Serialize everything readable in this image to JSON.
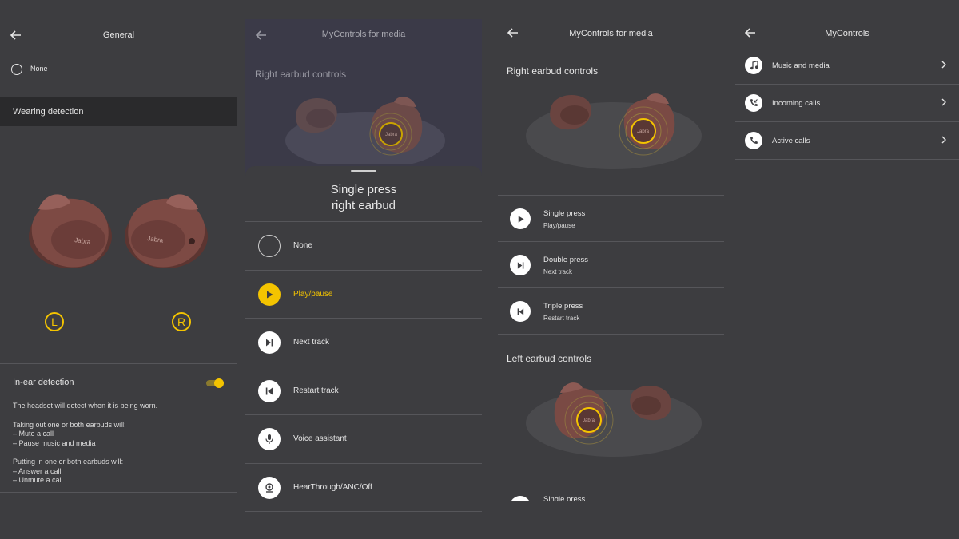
{
  "panel1": {
    "title": "General",
    "none_label": "None",
    "wearing_label": "Wearing detection",
    "left_badge": "L",
    "right_badge": "R",
    "earbud_brand": "Jabra",
    "inear_label": "In-ear detection",
    "toggle_on": true,
    "desc_line1": "The headset will detect when it is being worn.",
    "desc_taking": "Taking out one or both earbuds will:",
    "desc_t1": "– Mute a call",
    "desc_t2": "– Pause music and media",
    "desc_putting": "Putting in one or both earbuds will:",
    "desc_p1": "– Answer a call",
    "desc_p2": "– Unmute a call"
  },
  "panel2": {
    "title": "MyControls for media",
    "bg_section": "Right earbud controls",
    "earbud_brand": "Jabra",
    "sheet_title_1": "Single press",
    "sheet_title_2": "right earbud",
    "options": [
      {
        "label": "None",
        "icon": "empty-circle-icon"
      },
      {
        "label": "Play/pause",
        "icon": "play-icon",
        "selected": true
      },
      {
        "label": "Next track",
        "icon": "next-track-icon"
      },
      {
        "label": "Restart track",
        "icon": "restart-track-icon"
      },
      {
        "label": "Voice assistant",
        "icon": "microphone-icon"
      },
      {
        "label": "HearThrough/ANC/Off",
        "icon": "hearthrough-icon"
      }
    ]
  },
  "panel3": {
    "title": "MyControls for media",
    "right_section": "Right earbud controls",
    "left_section": "Left earbud controls",
    "earbud_brand": "Jabra",
    "controls": [
      {
        "title": "Single press",
        "value": "Play/pause",
        "icon": "play-icon"
      },
      {
        "title": "Double press",
        "value": "Next track",
        "icon": "next-track-icon"
      },
      {
        "title": "Triple press",
        "value": "Restart track",
        "icon": "restart-track-icon"
      }
    ],
    "left_partial": "Single press"
  },
  "panel4": {
    "title": "MyControls",
    "items": [
      {
        "label": "Music and media",
        "icon": "music-note-icon"
      },
      {
        "label": "Incoming calls",
        "icon": "incoming-call-icon"
      },
      {
        "label": "Active calls",
        "icon": "phone-icon"
      }
    ]
  },
  "colors": {
    "background": "#3d3d40",
    "accent": "#f4c400",
    "highlight_row": "#2a2a2c",
    "earbud": "#7a4a44"
  }
}
